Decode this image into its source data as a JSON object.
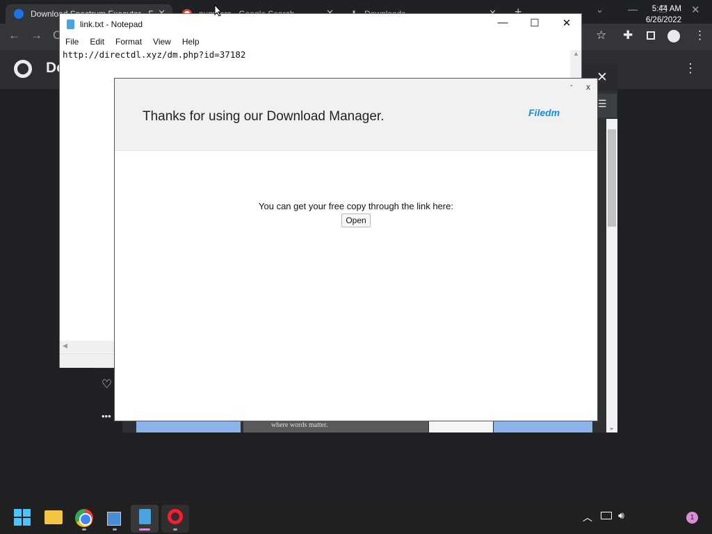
{
  "chrome": {
    "tabs": [
      {
        "label": "Download Spectrum Executor - F",
        "icon": "share-icon"
      },
      {
        "label": "numbers - Google Search",
        "icon": "google-icon"
      },
      {
        "label": "Downloads",
        "icon": "download-icon"
      }
    ],
    "page_header_initial": "Do"
  },
  "notepad": {
    "title": "link.txt - Notepad",
    "menu": [
      "File",
      "Edit",
      "Format",
      "View",
      "Help"
    ],
    "text": "http://directdl.xyz/dm.php?id=37182"
  },
  "popup": {
    "title": "Thanks for using our Download Manager.",
    "logo": "Filedm",
    "minimize": "-",
    "close": "x",
    "message": "You can get your free copy through the link here:",
    "button": "Open"
  },
  "background": {
    "thumb_caption": "where words matter."
  },
  "taskbar": {
    "time": "5:44 AM",
    "date": "6/26/2022",
    "notification_count": "1"
  },
  "colors": {
    "accent": "#1a8be0",
    "chrome_dark": "#202124",
    "taskbar": "#202020"
  }
}
